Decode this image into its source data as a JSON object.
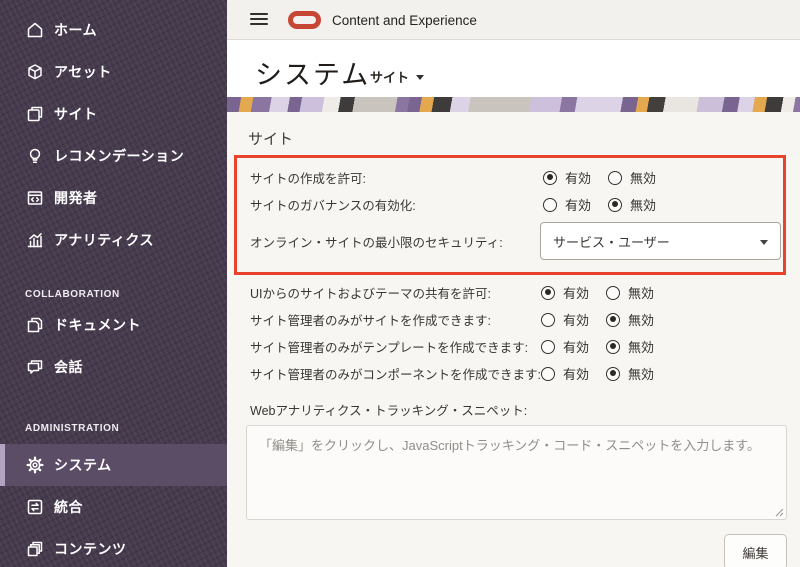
{
  "header": {
    "brand": "Content and Experience"
  },
  "titlebar": {
    "title": "システム",
    "scope_selector": "サイト"
  },
  "sidebar": {
    "items": [
      {
        "label": "ホーム",
        "icon": "home-icon"
      },
      {
        "label": "アセット",
        "icon": "assets-icon"
      },
      {
        "label": "サイト",
        "icon": "sites-icon"
      },
      {
        "label": "レコメンデーション",
        "icon": "recommendations-icon"
      },
      {
        "label": "開発者",
        "icon": "developer-icon"
      },
      {
        "label": "アナリティクス",
        "icon": "analytics-icon"
      }
    ],
    "collaboration_header": "COLLABORATION",
    "collaboration_items": [
      {
        "label": "ドキュメント",
        "icon": "documents-icon"
      },
      {
        "label": "会話",
        "icon": "conversations-icon"
      }
    ],
    "administration_header": "ADMINISTRATION",
    "administration_items": [
      {
        "label": "システム",
        "icon": "system-icon",
        "selected": true
      },
      {
        "label": "統合",
        "icon": "integration-icon",
        "selected": false
      },
      {
        "label": "コンテンツ",
        "icon": "content-icon",
        "selected": false
      }
    ]
  },
  "main": {
    "section_title": "サイト",
    "radio_on_label": "有効",
    "radio_off_label": "無効",
    "highlighted_rows": [
      {
        "label": "サイトの作成を許可:",
        "enabled": true
      },
      {
        "label": "サイトのガバナンスの有効化:",
        "enabled": false
      }
    ],
    "security_dropdown": {
      "label": "オンライン・サイトの最小限のセキュリティ:",
      "value": "サービス・ユーザー"
    },
    "rows": [
      {
        "label": "UIからのサイトおよびテーマの共有を許可:",
        "enabled": true
      },
      {
        "label": "サイト管理者のみがサイトを作成できます:",
        "enabled": false
      },
      {
        "label": "サイト管理者のみがテンプレートを作成できます:",
        "enabled": false
      },
      {
        "label": "サイト管理者のみがコンポーネントを作成できます:",
        "enabled": false
      }
    ],
    "analytics": {
      "label": "Webアナリティクス・トラッキング・スニペット:",
      "placeholder": "「編集」をクリックし、JavaScriptトラッキング・コード・スニペットを入力します。",
      "edit_button": "編集"
    }
  },
  "colors": {
    "annotation_red": "#e8432d",
    "oracle_red": "#c74634",
    "sidebar_bg": "#463a4d",
    "sidebar_selected_bg": "#5c4d66",
    "sidebar_selected_bar": "#b3a2c2"
  }
}
